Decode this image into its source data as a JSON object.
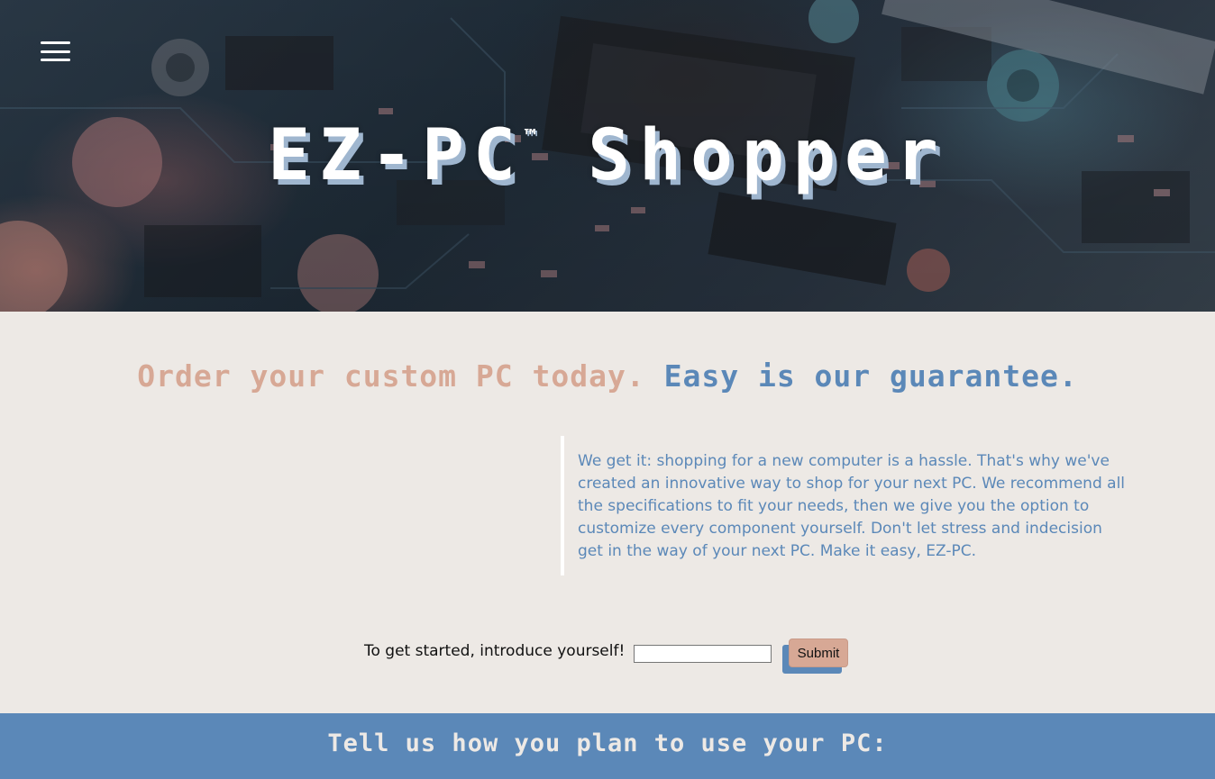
{
  "hero": {
    "title": "EZ-PC",
    "trademark": "™",
    "title_suffix": "Shopper",
    "menu_icon": "hamburger-menu-icon",
    "background": "circuit-board-photo"
  },
  "tagline": {
    "part1": "Order your custom PC today.",
    "part2": "Easy is our guarantee."
  },
  "intro": {
    "text": "We get it: shopping for a new computer is a hassle. That's why we've created an innovative way to shop for your next PC. We recommend all the specifications to fit your needs, then we give you the option to customize every component yourself. Don't let stress and indecision get in the way of your next PC. Make it easy, EZ-PC."
  },
  "form": {
    "label": "To get started, introduce yourself!",
    "input_value": "",
    "submit_label": "Submit"
  },
  "usage_section": {
    "title": "Tell us how you plan to use your PC:"
  },
  "colors": {
    "background": "#ede9e5",
    "accent_blue": "#5b88b8",
    "accent_peach": "#d7a895",
    "white": "#ffffff"
  }
}
